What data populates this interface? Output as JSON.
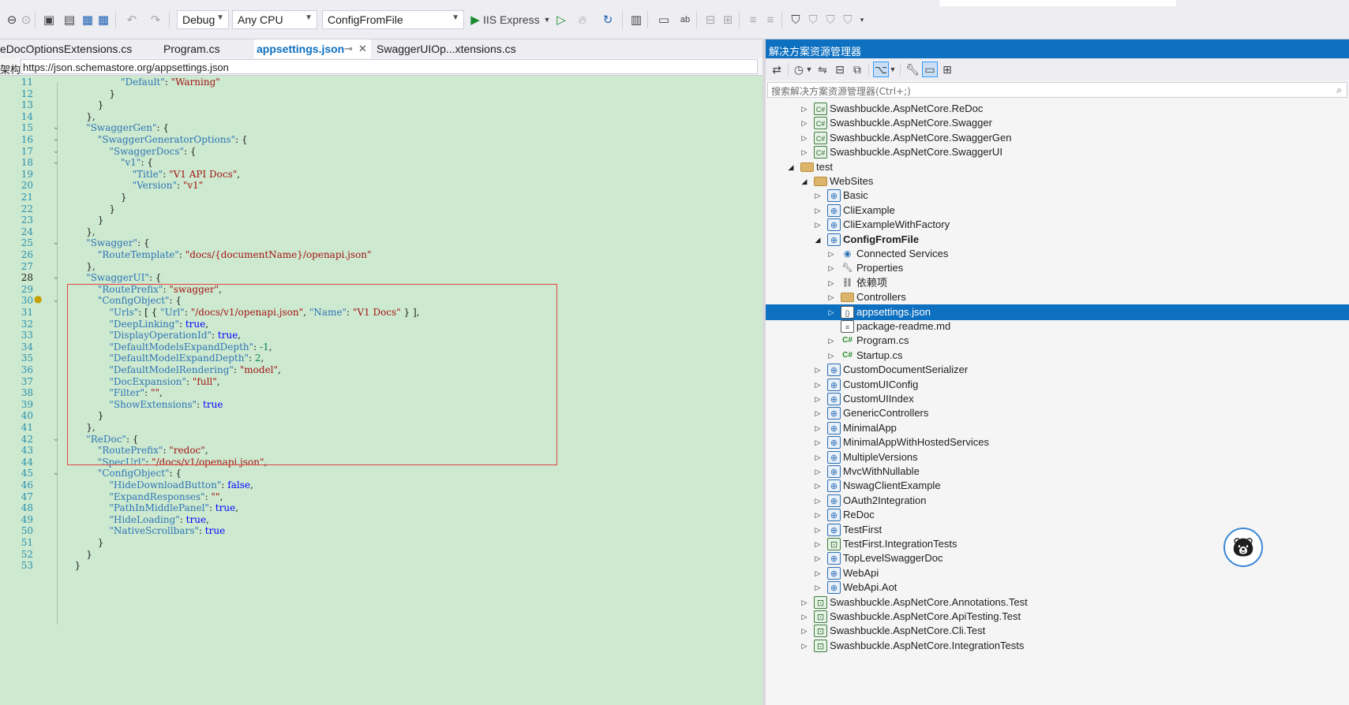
{
  "toolbar": {
    "config": "Debug",
    "platform": "Any CPU",
    "startup_project": "ConfigFromFile",
    "run_label": "IIS Express"
  },
  "editor_tabs": [
    {
      "label": "eDocOptionsExtensions.cs",
      "active": false
    },
    {
      "label": "Program.cs",
      "active": false
    },
    {
      "label": "appsettings.json",
      "active": true
    },
    {
      "label": "SwaggerUIOp...xtensions.cs",
      "active": false
    }
  ],
  "schema": {
    "label": "架构:",
    "url": "https://json.schemastore.org/appsettings.json"
  },
  "editor": {
    "current_line": 28,
    "lines": [
      {
        "n": 11,
        "segs": [
          [
            "k",
            "\"Default\""
          ],
          [
            "p",
            ": "
          ],
          [
            "s",
            "\"Warning\""
          ]
        ],
        "indent": 10
      },
      {
        "n": 12,
        "segs": [
          [
            "p",
            "}"
          ]
        ],
        "indent": 8
      },
      {
        "n": 13,
        "segs": [
          [
            "p",
            "}"
          ]
        ],
        "indent": 6
      },
      {
        "n": 14,
        "segs": [
          [
            "p",
            "},"
          ]
        ],
        "indent": 4
      },
      {
        "n": 15,
        "segs": [
          [
            "k",
            "\"SwaggerGen\""
          ],
          [
            "p",
            ": {"
          ]
        ],
        "indent": 4
      },
      {
        "n": 16,
        "segs": [
          [
            "k",
            "\"SwaggerGeneratorOptions\""
          ],
          [
            "p",
            ": {"
          ]
        ],
        "indent": 6
      },
      {
        "n": 17,
        "segs": [
          [
            "k",
            "\"SwaggerDocs\""
          ],
          [
            "p",
            ": {"
          ]
        ],
        "indent": 8
      },
      {
        "n": 18,
        "segs": [
          [
            "k",
            "\"v1\""
          ],
          [
            "p",
            ": {"
          ]
        ],
        "indent": 10
      },
      {
        "n": 19,
        "segs": [
          [
            "k",
            "\"Title\""
          ],
          [
            "p",
            ": "
          ],
          [
            "s",
            "\"V1 API Docs\""
          ],
          [
            "p",
            ","
          ]
        ],
        "indent": 12
      },
      {
        "n": 20,
        "segs": [
          [
            "k",
            "\"Version\""
          ],
          [
            "p",
            ": "
          ],
          [
            "s",
            "\"v1\""
          ]
        ],
        "indent": 12
      },
      {
        "n": 21,
        "segs": [
          [
            "p",
            "}"
          ]
        ],
        "indent": 10
      },
      {
        "n": 22,
        "segs": [
          [
            "p",
            "}"
          ]
        ],
        "indent": 8
      },
      {
        "n": 23,
        "segs": [
          [
            "p",
            "}"
          ]
        ],
        "indent": 6
      },
      {
        "n": 24,
        "segs": [
          [
            "p",
            "},"
          ]
        ],
        "indent": 4
      },
      {
        "n": 25,
        "segs": [
          [
            "k",
            "\"Swagger\""
          ],
          [
            "p",
            ": {"
          ]
        ],
        "indent": 4
      },
      {
        "n": 26,
        "segs": [
          [
            "k",
            "\"RouteTemplate\""
          ],
          [
            "p",
            ": "
          ],
          [
            "s",
            "\"docs/{documentName}/openapi.json\""
          ]
        ],
        "indent": 6
      },
      {
        "n": 27,
        "segs": [
          [
            "p",
            "},"
          ]
        ],
        "indent": 4
      },
      {
        "n": 28,
        "segs": [
          [
            "k",
            "\"SwaggerUI\""
          ],
          [
            "p",
            ": {"
          ]
        ],
        "indent": 4
      },
      {
        "n": 29,
        "segs": [
          [
            "k",
            "\"RoutePrefix\""
          ],
          [
            "p",
            ": "
          ],
          [
            "s",
            "\"swagger\""
          ],
          [
            "p",
            ","
          ]
        ],
        "indent": 6
      },
      {
        "n": 30,
        "segs": [
          [
            "k",
            "\"ConfigObject\""
          ],
          [
            "p",
            ": {"
          ]
        ],
        "indent": 6
      },
      {
        "n": 31,
        "segs": [
          [
            "k",
            "\"Urls\""
          ],
          [
            "p",
            ": [ { "
          ],
          [
            "k",
            "\"Url\""
          ],
          [
            "p",
            ": "
          ],
          [
            "s",
            "\"/docs/v1/openapi.json\""
          ],
          [
            "p",
            ", "
          ],
          [
            "k",
            "\"Name\""
          ],
          [
            "p",
            ": "
          ],
          [
            "s",
            "\"V1 Docs\""
          ],
          [
            "p",
            " } ],"
          ]
        ],
        "indent": 8
      },
      {
        "n": 32,
        "segs": [
          [
            "k",
            "\"DeepLinking\""
          ],
          [
            "p",
            ": "
          ],
          [
            "t",
            "true"
          ],
          [
            "p",
            ","
          ]
        ],
        "indent": 8
      },
      {
        "n": 33,
        "segs": [
          [
            "k",
            "\"DisplayOperationId\""
          ],
          [
            "p",
            ": "
          ],
          [
            "t",
            "true"
          ],
          [
            "p",
            ","
          ]
        ],
        "indent": 8
      },
      {
        "n": 34,
        "segs": [
          [
            "k",
            "\"DefaultModelsExpandDepth\""
          ],
          [
            "p",
            ": "
          ],
          [
            "n",
            "-1"
          ],
          [
            "p",
            ","
          ]
        ],
        "indent": 8
      },
      {
        "n": 35,
        "segs": [
          [
            "k",
            "\"DefaultModelExpandDepth\""
          ],
          [
            "p",
            ": "
          ],
          [
            "n",
            "2"
          ],
          [
            "p",
            ","
          ]
        ],
        "indent": 8
      },
      {
        "n": 36,
        "segs": [
          [
            "k",
            "\"DefaultModelRendering\""
          ],
          [
            "p",
            ": "
          ],
          [
            "s",
            "\"model\""
          ],
          [
            "p",
            ","
          ]
        ],
        "indent": 8
      },
      {
        "n": 37,
        "segs": [
          [
            "k",
            "\"DocExpansion\""
          ],
          [
            "p",
            ": "
          ],
          [
            "s",
            "\"full\""
          ],
          [
            "p",
            ","
          ]
        ],
        "indent": 8
      },
      {
        "n": 38,
        "segs": [
          [
            "k",
            "\"Filter\""
          ],
          [
            "p",
            ": "
          ],
          [
            "s",
            "\"\""
          ],
          [
            "p",
            ","
          ]
        ],
        "indent": 8
      },
      {
        "n": 39,
        "segs": [
          [
            "k",
            "\"ShowExtensions\""
          ],
          [
            "p",
            ": "
          ],
          [
            "t",
            "true"
          ]
        ],
        "indent": 8
      },
      {
        "n": 40,
        "segs": [
          [
            "p",
            "}"
          ]
        ],
        "indent": 6
      },
      {
        "n": 41,
        "segs": [
          [
            "p",
            "},"
          ]
        ],
        "indent": 4
      },
      {
        "n": 42,
        "segs": [
          [
            "k",
            "\"ReDoc\""
          ],
          [
            "p",
            ": {"
          ]
        ],
        "indent": 4
      },
      {
        "n": 43,
        "segs": [
          [
            "k",
            "\"RoutePrefix\""
          ],
          [
            "p",
            ": "
          ],
          [
            "s",
            "\"redoc\""
          ],
          [
            "p",
            ","
          ]
        ],
        "indent": 6
      },
      {
        "n": 44,
        "segs": [
          [
            "k",
            "\"SpecUrl\""
          ],
          [
            "p",
            ": "
          ],
          [
            "s",
            "\"/docs/v1/openapi.json\""
          ],
          [
            "p",
            ","
          ]
        ],
        "indent": 6
      },
      {
        "n": 45,
        "segs": [
          [
            "k",
            "\"ConfigObject\""
          ],
          [
            "p",
            ": {"
          ]
        ],
        "indent": 6
      },
      {
        "n": 46,
        "segs": [
          [
            "k",
            "\"HideDownloadButton\""
          ],
          [
            "p",
            ": "
          ],
          [
            "t",
            "false"
          ],
          [
            "p",
            ","
          ]
        ],
        "indent": 8
      },
      {
        "n": 47,
        "segs": [
          [
            "k",
            "\"ExpandResponses\""
          ],
          [
            "p",
            ": "
          ],
          [
            "s",
            "\"\""
          ],
          [
            "p",
            ","
          ]
        ],
        "indent": 8
      },
      {
        "n": 48,
        "segs": [
          [
            "k",
            "\"PathInMiddlePanel\""
          ],
          [
            "p",
            ": "
          ],
          [
            "t",
            "true"
          ],
          [
            "p",
            ","
          ]
        ],
        "indent": 8
      },
      {
        "n": 49,
        "segs": [
          [
            "k",
            "\"HideLoading\""
          ],
          [
            "p",
            ": "
          ],
          [
            "t",
            "true"
          ],
          [
            "p",
            ","
          ]
        ],
        "indent": 8
      },
      {
        "n": 50,
        "segs": [
          [
            "k",
            "\"NativeScrollbars\""
          ],
          [
            "p",
            ": "
          ],
          [
            "t",
            "true"
          ]
        ],
        "indent": 8
      },
      {
        "n": 51,
        "segs": [
          [
            "p",
            "}"
          ]
        ],
        "indent": 6
      },
      {
        "n": 52,
        "segs": [
          [
            "p",
            "}"
          ]
        ],
        "indent": 4
      },
      {
        "n": 53,
        "segs": [
          [
            "p",
            "}"
          ]
        ],
        "indent": 2
      }
    ]
  },
  "solution_explorer": {
    "title": "解决方案资源管理器",
    "search_placeholder": "搜索解决方案资源管理器(Ctrl+;)",
    "items": [
      {
        "label": "Swashbuckle.AspNetCore.ReDoc",
        "level": 1,
        "icon": "csproj",
        "expander": "collapsed"
      },
      {
        "label": "Swashbuckle.AspNetCore.Swagger",
        "level": 1,
        "icon": "csproj",
        "expander": "collapsed"
      },
      {
        "label": "Swashbuckle.AspNetCore.SwaggerGen",
        "level": 1,
        "icon": "csproj",
        "expander": "collapsed"
      },
      {
        "label": "Swashbuckle.AspNetCore.SwaggerUI",
        "level": 1,
        "icon": "csproj",
        "expander": "collapsed"
      },
      {
        "label": "test",
        "level": 0,
        "icon": "folder",
        "expander": "expanded"
      },
      {
        "label": "WebSites",
        "level": 1,
        "icon": "folder",
        "expander": "expanded"
      },
      {
        "label": "Basic",
        "level": 2,
        "icon": "web",
        "expander": "collapsed"
      },
      {
        "label": "CliExample",
        "level": 2,
        "icon": "web",
        "expander": "collapsed"
      },
      {
        "label": "CliExampleWithFactory",
        "level": 2,
        "icon": "web",
        "expander": "collapsed"
      },
      {
        "label": "ConfigFromFile",
        "level": 2,
        "icon": "web",
        "expander": "expanded",
        "bold": true
      },
      {
        "label": "Connected Services",
        "level": 3,
        "icon": "conn",
        "expander": "collapsed"
      },
      {
        "label": "Properties",
        "level": 3,
        "icon": "props",
        "expander": "collapsed"
      },
      {
        "label": "依赖项",
        "level": 3,
        "icon": "deps",
        "expander": "collapsed"
      },
      {
        "label": "Controllers",
        "level": 3,
        "icon": "folder",
        "expander": "collapsed"
      },
      {
        "label": "appsettings.json",
        "level": 3,
        "icon": "json",
        "expander": "collapsed",
        "selected": true
      },
      {
        "label": "package-readme.md",
        "level": 3,
        "icon": "md",
        "expander": "none"
      },
      {
        "label": "Program.cs",
        "level": 3,
        "icon": "cs",
        "expander": "collapsed"
      },
      {
        "label": "Startup.cs",
        "level": 3,
        "icon": "cs",
        "expander": "collapsed"
      },
      {
        "label": "CustomDocumentSerializer",
        "level": 2,
        "icon": "web",
        "expander": "collapsed"
      },
      {
        "label": "CustomUIConfig",
        "level": 2,
        "icon": "web",
        "expander": "collapsed"
      },
      {
        "label": "CustomUIIndex",
        "level": 2,
        "icon": "web",
        "expander": "collapsed"
      },
      {
        "label": "GenericControllers",
        "level": 2,
        "icon": "web",
        "expander": "collapsed"
      },
      {
        "label": "MinimalApp",
        "level": 2,
        "icon": "web",
        "expander": "collapsed"
      },
      {
        "label": "MinimalAppWithHostedServices",
        "level": 2,
        "icon": "web",
        "expander": "collapsed"
      },
      {
        "label": "MultipleVersions",
        "level": 2,
        "icon": "web",
        "expander": "collapsed"
      },
      {
        "label": "MvcWithNullable",
        "level": 2,
        "icon": "web",
        "expander": "collapsed"
      },
      {
        "label": "NswagClientExample",
        "level": 2,
        "icon": "web",
        "expander": "collapsed"
      },
      {
        "label": "OAuth2Integration",
        "level": 2,
        "icon": "web",
        "expander": "collapsed"
      },
      {
        "label": "ReDoc",
        "level": 2,
        "icon": "web",
        "expander": "collapsed"
      },
      {
        "label": "TestFirst",
        "level": 2,
        "icon": "web",
        "expander": "collapsed"
      },
      {
        "label": "TestFirst.IntegrationTests",
        "level": 2,
        "icon": "test",
        "expander": "collapsed"
      },
      {
        "label": "TopLevelSwaggerDoc",
        "level": 2,
        "icon": "web",
        "expander": "collapsed"
      },
      {
        "label": "WebApi",
        "level": 2,
        "icon": "web",
        "expander": "collapsed"
      },
      {
        "label": "WebApi.Aot",
        "level": 2,
        "icon": "web",
        "expander": "collapsed"
      },
      {
        "label": "Swashbuckle.AspNetCore.Annotations.Test",
        "level": 1,
        "icon": "test",
        "expander": "collapsed"
      },
      {
        "label": "Swashbuckle.AspNetCore.ApiTesting.Test",
        "level": 1,
        "icon": "test",
        "expander": "collapsed"
      },
      {
        "label": "Swashbuckle.AspNetCore.Cli.Test",
        "level": 1,
        "icon": "test",
        "expander": "collapsed"
      },
      {
        "label": "Swashbuckle.AspNetCore.IntegrationTests",
        "level": 1,
        "icon": "test",
        "expander": "collapsed"
      }
    ]
  },
  "colors": {
    "accent": "#0e70c0",
    "editor_bg": "#cde9cf",
    "highlight_box": "#e24545"
  }
}
